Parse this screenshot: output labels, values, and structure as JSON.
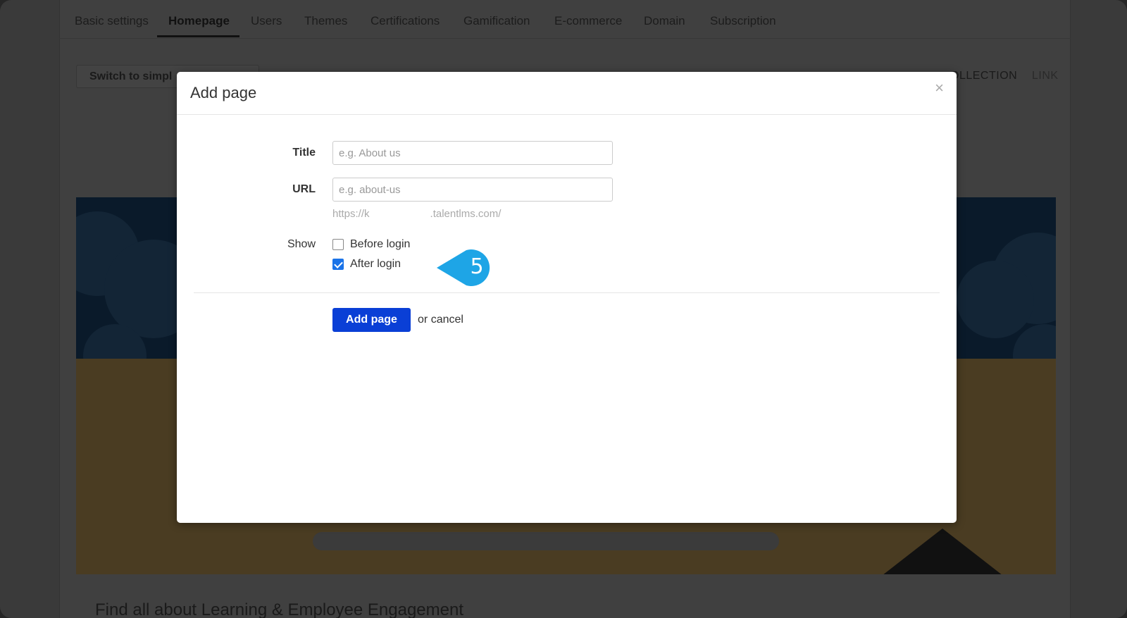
{
  "tabs": [
    {
      "label": "Basic settings"
    },
    {
      "label": "Homepage"
    },
    {
      "label": "Users"
    },
    {
      "label": "Themes"
    },
    {
      "label": "Certifications"
    },
    {
      "label": "Gamification"
    },
    {
      "label": "E-commerce"
    },
    {
      "label": "Domain"
    },
    {
      "label": "Subscription"
    }
  ],
  "active_tab": "Homepage",
  "toolbar": {
    "switch_label": "Switch to simpl",
    "collection_label": "OLLECTION",
    "link_label": "LINK"
  },
  "background_text": "Find all about Learning & Employee Engagement",
  "modal": {
    "title": "Add page",
    "close_glyph": "×",
    "title_label": "Title",
    "title_placeholder": "e.g. About us",
    "url_label": "URL",
    "url_placeholder": "e.g. about-us",
    "url_prefix": "https://k",
    "url_suffix": ".talentlms.com/",
    "show_label": "Show",
    "before_login_label": "Before login",
    "after_login_label": "After login",
    "submit_label": "Add page",
    "cancel_prefix": "or",
    "cancel_label": "cancel"
  },
  "checkboxes": {
    "before_login_checked": false,
    "after_login_checked": true
  },
  "callout": {
    "number": "5",
    "color": "#1ea5e6"
  },
  "colors": {
    "primary_button": "#0a3fd6",
    "checkbox_checked": "#1a73e8"
  }
}
